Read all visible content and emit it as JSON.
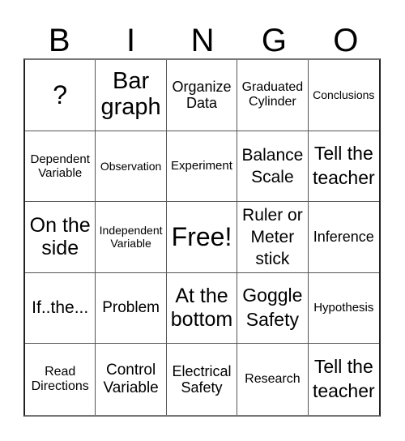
{
  "header": [
    "B",
    "I",
    "N",
    "G",
    "O"
  ],
  "cells": [
    "?",
    "Bar graph",
    "Organize Data",
    "Graduated Cylinder",
    "Conclusions",
    "Dependent Variable",
    "Observation",
    "Experiment",
    "Balance Scale",
    "Tell the teacher",
    "On the side",
    "Independent Variable",
    "Free!",
    "Ruler or Meter stick",
    "Inference",
    "If..the...",
    "Problem",
    "At the bottom",
    "Goggle Safety",
    "Hypothesis",
    "Read Directions",
    "Control Variable",
    "Electrical Safety",
    "Research",
    "Tell the teacher"
  ]
}
